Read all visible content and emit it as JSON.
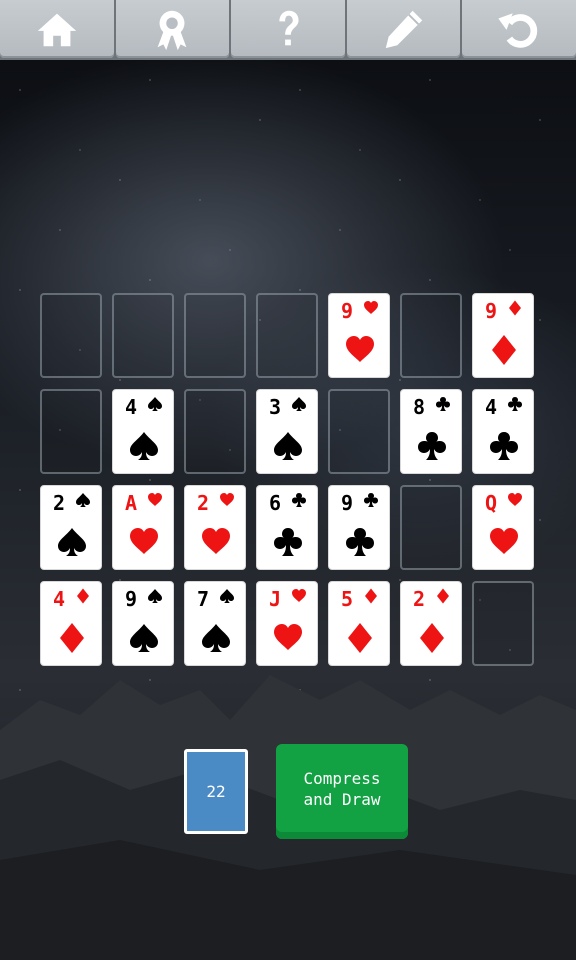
{
  "toolbar": {
    "buttons": [
      {
        "icon": "home-icon"
      },
      {
        "icon": "award-icon"
      },
      {
        "icon": "help-icon"
      },
      {
        "icon": "pencil-icon"
      },
      {
        "icon": "undo-icon"
      }
    ]
  },
  "tableau": [
    [
      {
        "empty": true
      },
      {
        "empty": true
      },
      {
        "empty": true
      },
      {
        "empty": true
      },
      {
        "rank": "9",
        "suit": "hearts"
      },
      {
        "empty": true
      },
      {
        "rank": "9",
        "suit": "diamonds"
      }
    ],
    [
      {
        "empty": true
      },
      {
        "rank": "4",
        "suit": "spades"
      },
      {
        "empty": true
      },
      {
        "rank": "3",
        "suit": "spades"
      },
      {
        "empty": true
      },
      {
        "rank": "8",
        "suit": "clubs"
      },
      {
        "rank": "4",
        "suit": "clubs"
      }
    ],
    [
      {
        "rank": "2",
        "suit": "spades"
      },
      {
        "rank": "A",
        "suit": "hearts"
      },
      {
        "rank": "2",
        "suit": "hearts"
      },
      {
        "rank": "6",
        "suit": "clubs"
      },
      {
        "rank": "9",
        "suit": "clubs"
      },
      {
        "empty": true
      },
      {
        "rank": "Q",
        "suit": "hearts"
      }
    ],
    [
      {
        "rank": "4",
        "suit": "diamonds"
      },
      {
        "rank": "9",
        "suit": "spades"
      },
      {
        "rank": "7",
        "suit": "spades"
      },
      {
        "rank": "J",
        "suit": "hearts"
      },
      {
        "rank": "5",
        "suit": "diamonds"
      },
      {
        "rank": "2",
        "suit": "diamonds"
      },
      {
        "empty": true
      }
    ]
  ],
  "stock": {
    "count": "22",
    "color": "#4a8ac5"
  },
  "action_button": {
    "label": "Compress\nand Draw",
    "color": "#12a244"
  },
  "colors": {
    "red": "#ee1414",
    "black": "#000000"
  }
}
